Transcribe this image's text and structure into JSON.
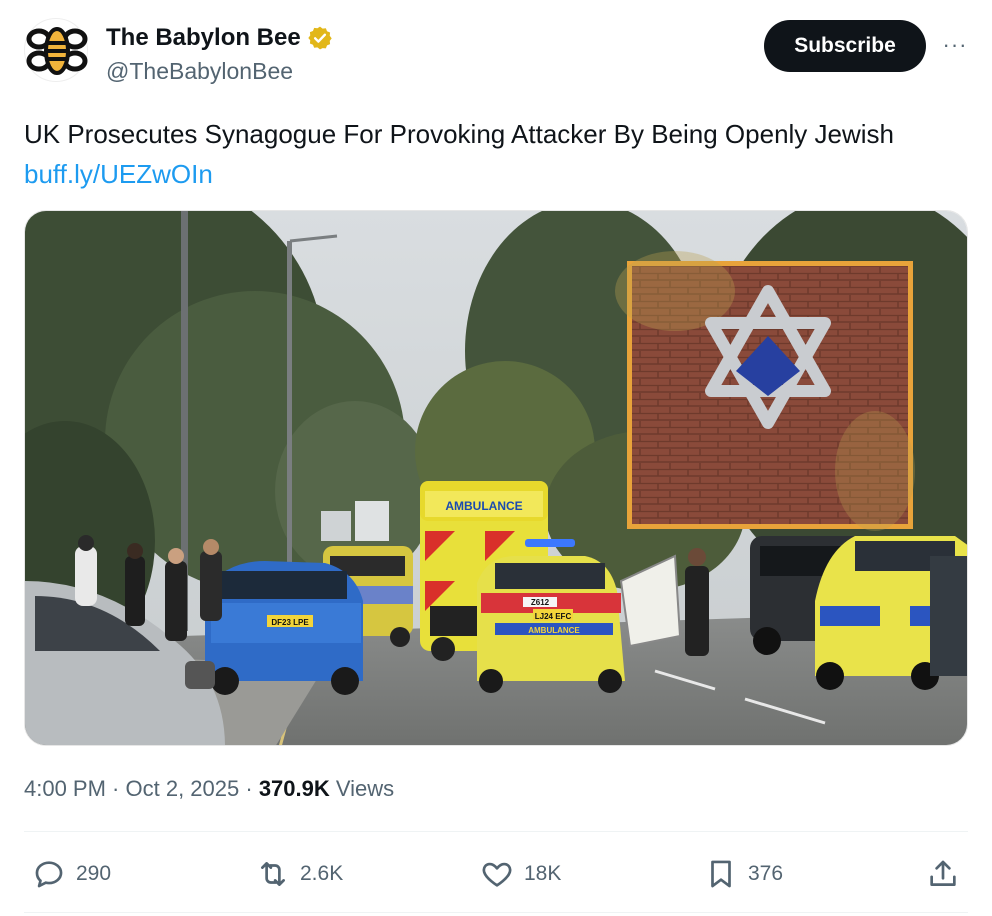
{
  "account": {
    "display_name": "The Babylon Bee",
    "handle": "@TheBabylonBee",
    "verified_badge": "gold-check-icon",
    "subscribe_label": "Subscribe",
    "more_label": "···"
  },
  "tweet": {
    "text": "UK Prosecutes Synagogue For Provoking Attacker By Being Openly Jewish",
    "link": "buff.ly/UEZwOIn"
  },
  "media": {
    "vehicle_texts": {
      "ambulance": "AMBULANCE",
      "bmw_plate": "DF23 LPE",
      "car_plate": "LJ24 EFC",
      "car_number": "Z612",
      "car_rear_text": "AMBULANCE"
    }
  },
  "meta": {
    "time": "4:00 PM",
    "separator": " · ",
    "date": "Oct 2, 2025",
    "views_count": "370.9K",
    "views_label": " Views"
  },
  "actions": {
    "replies": "290",
    "reposts": "2.6K",
    "likes": "18K",
    "bookmarks": "376"
  },
  "colors": {
    "text": "#0f1419",
    "secondary": "#536471",
    "link": "#1d9bf0",
    "button_bg": "#0f1419",
    "inset_border": "#e8a33a"
  }
}
